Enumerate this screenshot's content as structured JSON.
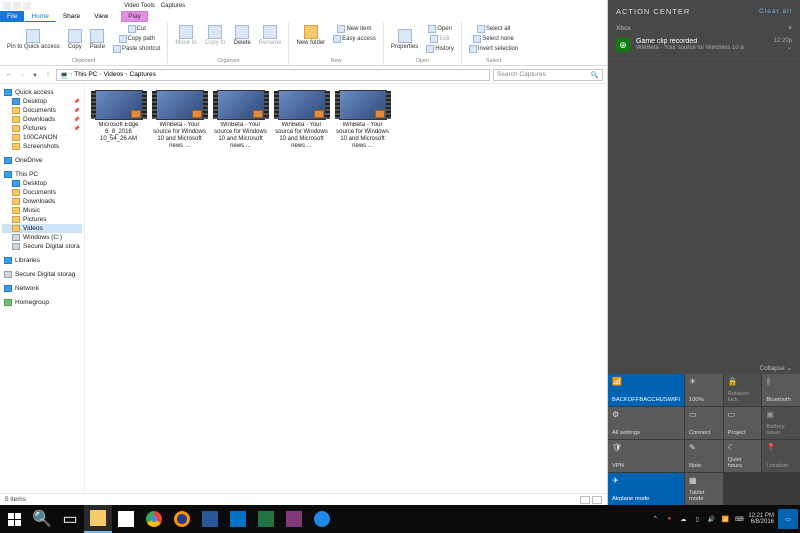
{
  "explorer": {
    "ribbon_tabs": {
      "file": "File",
      "home": "Home",
      "share": "Share",
      "view": "View",
      "ctx_label": "Video Tools",
      "ctx_tab": "Play",
      "title": "Captures"
    },
    "ribbon": {
      "clipboard": {
        "pin": "Pin to Quick access",
        "copy": "Copy",
        "paste": "Paste",
        "cut": "Cut",
        "copypath": "Copy path",
        "shortcut": "Paste shortcut",
        "label": "Clipboard"
      },
      "organize": {
        "moveto": "Move to",
        "copyto": "Copy to",
        "delete": "Delete",
        "rename": "Rename",
        "label": "Organize"
      },
      "new": {
        "newfolder": "New folder",
        "newitem": "New item",
        "easyaccess": "Easy access",
        "label": "New"
      },
      "open": {
        "properties": "Properties",
        "open": "Open",
        "edit": "Edit",
        "history": "History",
        "label": "Open"
      },
      "select": {
        "all": "Select all",
        "none": "Select none",
        "invert": "Invert selection",
        "label": "Select"
      }
    },
    "breadcrumb": {
      "root": "This PC",
      "p1": "Videos",
      "p2": "Captures"
    },
    "search_placeholder": "Search Captures",
    "nav": {
      "quick": "Quick access",
      "desktop": "Desktop",
      "documents": "Documents",
      "downloads": "Downloads",
      "pictures": "Pictures",
      "canon": "100CANON",
      "screenshots": "Screenshots",
      "onedrive": "OneDrive",
      "thispc": "This PC",
      "music": "Music",
      "videos": "Videos",
      "cdrive": "Windows (C:)",
      "sd": "Secure Digital stora",
      "libraries": "Libraries",
      "sd2": "Secure Digital storag",
      "network": "Network",
      "homegroup": "Homegroup"
    },
    "files": [
      {
        "name": "Microsoft Edge 6_8_2016 10_54_26 AM"
      },
      {
        "name": "WinBeta - Your source for Windows 10 and Microsoft news ..."
      },
      {
        "name": "WinBeta - Your source for Windows 10 and Microsoft news ..."
      },
      {
        "name": "WinBeta - Your source for Windows 10 and Microsoft news ..."
      },
      {
        "name": "WinBeta - Your source for Windows 10 and Microsoft news ..."
      }
    ],
    "status": "5 items"
  },
  "action_center": {
    "title": "ACTION CENTER",
    "clear": "Clear all",
    "group": "Xbox",
    "notif": {
      "title": "Game clip recorded",
      "sub": "WinBeta - Your source for Windows 10 a",
      "time": "12:20p"
    },
    "collapse": "Collapse",
    "tiles": [
      {
        "label": "BACKOFFBACCHUSWIFI",
        "state": "on",
        "icon": "📶"
      },
      {
        "label": "100%",
        "state": "",
        "icon": "☀"
      },
      {
        "label": "Rotation lock",
        "state": "dim",
        "icon": "🔒"
      },
      {
        "label": "Bluetooth",
        "state": "",
        "icon": "ᛒ"
      },
      {
        "label": "All settings",
        "state": "",
        "icon": "⚙"
      },
      {
        "label": "Connect",
        "state": "",
        "icon": "▭"
      },
      {
        "label": "Project",
        "state": "",
        "icon": "▭"
      },
      {
        "label": "Battery saver",
        "state": "dim",
        "icon": "▣"
      },
      {
        "label": "VPN",
        "state": "",
        "icon": "🛡"
      },
      {
        "label": "Note",
        "state": "",
        "icon": "✎"
      },
      {
        "label": "Quiet hours",
        "state": "",
        "icon": "☾"
      },
      {
        "label": "Location",
        "state": "dim",
        "icon": "📍"
      },
      {
        "label": "Airplane mode",
        "state": "on",
        "icon": "✈"
      },
      {
        "label": "Tablet mode",
        "state": "",
        "icon": "▦"
      }
    ]
  },
  "taskbar": {
    "time": "12:21 PM",
    "date": "6/8/2016"
  }
}
